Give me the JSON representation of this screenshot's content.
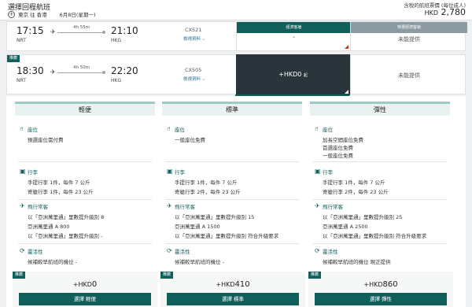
{
  "header": {
    "title": "選擇回程航班",
    "route": "東京 往 香港",
    "date": "6月8日(星期一)",
    "total_label": "含稅的航班票價 (每位成人)",
    "total_currency": "HKD",
    "total_amount": "2,780"
  },
  "flights": [
    {
      "dep_time": "17:15",
      "dep_airport": "NRT",
      "duration": "4h 55m",
      "arr_time": "21:10",
      "arr_airport": "HKG",
      "flight_no": "CX521",
      "details": "檢視資料 ⌵",
      "economy_tab": "經濟客艙",
      "premium_tab": "特選經濟客艙",
      "premium_status": "未能提供"
    },
    {
      "badge": "推薦",
      "dep_time": "18:30",
      "dep_airport": "NRT",
      "duration": "4h 50m",
      "arr_time": "22:20",
      "arr_airport": "HKG",
      "flight_no": "CX505",
      "details": "檢視資料 ⌵",
      "economy_price": "+HKD0",
      "economy_price_suffix": "起",
      "premium_status": "未能提供"
    }
  ],
  "fares": [
    {
      "name": "輕便",
      "seat_title": "座位",
      "seat_lines": [
        "預選座位需付費"
      ],
      "bag_title": "行李",
      "bag_lines": [
        "手提行李  1件，每件 7 公斤",
        "寄艙行李  1件，每件 23 公斤"
      ],
      "miles_title": "飛行常客",
      "miles_lines": [
        "以「亞洲萬里通」里數提升級別  8",
        "亞洲萬里通  A 800",
        "以「亞洲萬里通」里數提升級別  -"
      ],
      "flex_title": "靈活性",
      "flex_lines": [
        "候補較早航班的機位  -"
      ],
      "badge": "推薦",
      "price_currency": "+HKD",
      "price": "0",
      "button": "選擇 輕便"
    },
    {
      "name": "標準",
      "seat_title": "座位",
      "seat_lines": [
        "一般座位免費"
      ],
      "bag_title": "行李",
      "bag_lines": [
        "手提行李  1件，每件 7 公斤",
        "寄艙行李  2件，每件 23 公斤"
      ],
      "miles_title": "飛行常客",
      "miles_lines": [
        "以「亞洲萬里通」里數提升級別  15",
        "亞洲萬里通  A 1500",
        "以「亞洲萬里通」里數提升級別  符合升級要求"
      ],
      "flex_title": "靈活性",
      "flex_lines": [
        "候補較早航班的機位  -"
      ],
      "badge": "推薦",
      "price_currency": "+HKD",
      "price": "410",
      "button": "選擇 標準"
    },
    {
      "name": "彈性",
      "seat_title": "座位",
      "seat_lines": [
        "加長空間座位免費",
        "首選座位免費",
        "一般座位免費"
      ],
      "bag_title": "行李",
      "bag_lines": [
        "手提行李  1件，每件 7 公斤",
        "寄艙行李  2件，每件 23 公斤"
      ],
      "miles_title": "飛行常客",
      "miles_lines": [
        "以「亞洲萬里通」里數提升級別  25",
        "亞洲萬里通  A 2500",
        "以「亞洲萬里通」里數提升級別  符合升級要求"
      ],
      "flex_title": "靈活性",
      "flex_lines": [
        "候補較早航班的機位  現正提供"
      ],
      "badge": "推薦",
      "price_currency": "+HKD",
      "price": "860",
      "button": "選擇 彈性"
    }
  ],
  "icons": {
    "add": "+",
    "plane": "✈",
    "seat": "🪑",
    "bag": "🧳",
    "miles": "✈",
    "flex": "⟳",
    "chevron": "⌄"
  },
  "colors": {
    "brand_teal": "#105f5b",
    "selected_dark": "#2a353b",
    "premium_grey": "#8c9aa2",
    "link_blue": "#2a6f9a"
  }
}
